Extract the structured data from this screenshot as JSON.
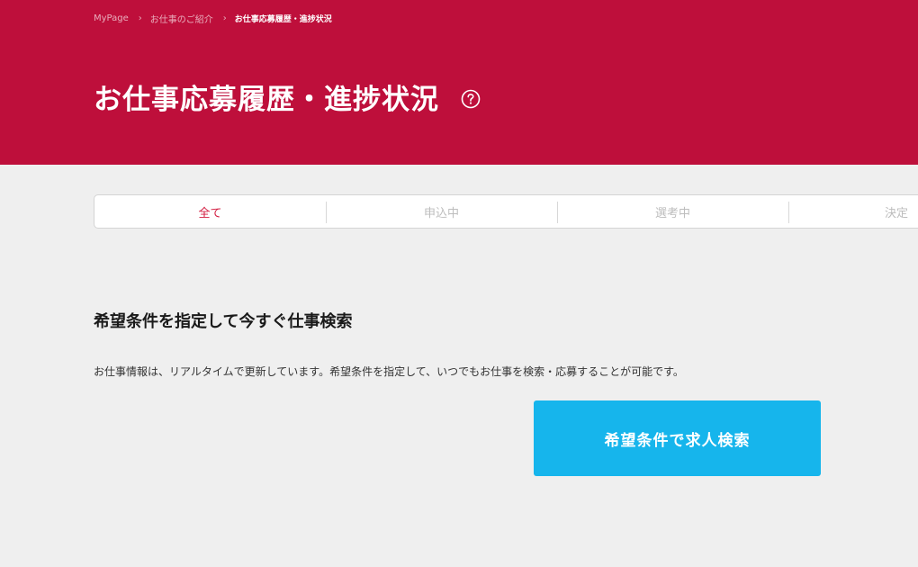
{
  "breadcrumb": {
    "items": [
      "MyPage",
      "お仕事のご紹介",
      "お仕事応募履歴・進捗状況"
    ],
    "separator": "›"
  },
  "header": {
    "title": "お仕事応募履歴・進捗状況",
    "help_icon": "question-circle-icon",
    "background": "#be0f3b"
  },
  "tabs": [
    {
      "label": "全て",
      "active": true
    },
    {
      "label": "申込中",
      "active": false
    },
    {
      "label": "選考中",
      "active": false
    },
    {
      "label": "決定",
      "active": false
    }
  ],
  "search_section": {
    "title": "希望条件を指定して今すぐ仕事検索",
    "description": "お仕事情報は、リアルタイムで更新しています。希望条件を指定して、いつでもお仕事を検索・応募することが可能です。",
    "button_label": "希望条件で求人検索",
    "button_color": "#16b5ec"
  },
  "colors": {
    "accent": "#be0f3b",
    "active_tab": "#d21b3f",
    "page_background": "#efefef"
  }
}
